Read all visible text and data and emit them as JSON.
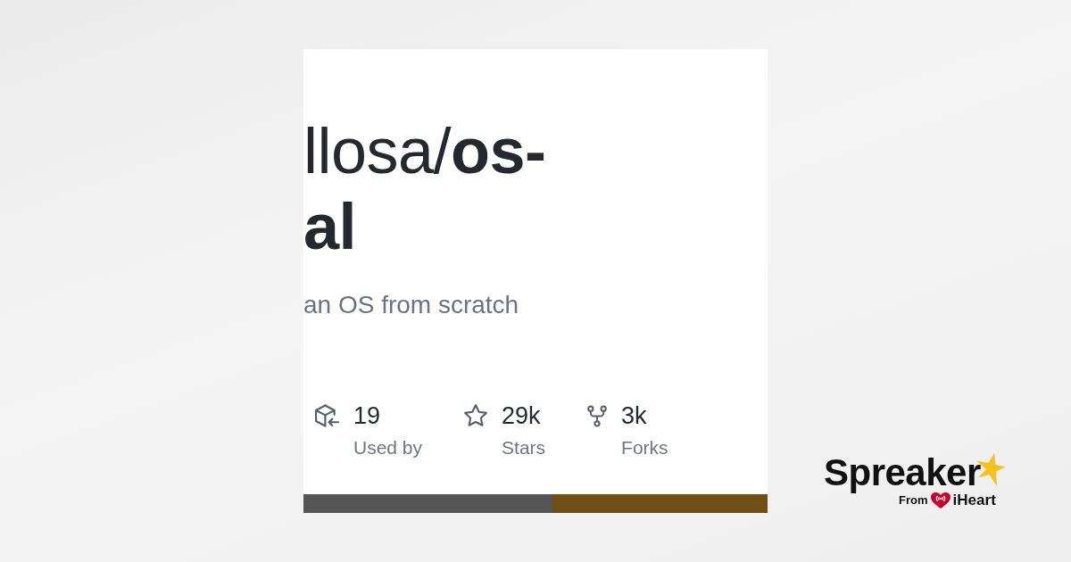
{
  "repository_card": {
    "title_lines": [
      "llosa/**os-**",
      "**al**"
    ],
    "description": "an OS from scratch",
    "stats": [
      {
        "kind": "used_by",
        "value": "19",
        "label": "Used by"
      },
      {
        "kind": "stars",
        "value": "29k",
        "label": "Stars"
      },
      {
        "kind": "forks",
        "value": "3k",
        "label": "Forks"
      }
    ],
    "language_bar": [
      {
        "color": "#555555",
        "level": 0.537
      },
      {
        "color": "#704f14",
        "level": 0.463
      }
    ]
  },
  "logo": {
    "wordmark": "Spreaker",
    "tagline_prefix": "From",
    "partner": "iHeart"
  }
}
